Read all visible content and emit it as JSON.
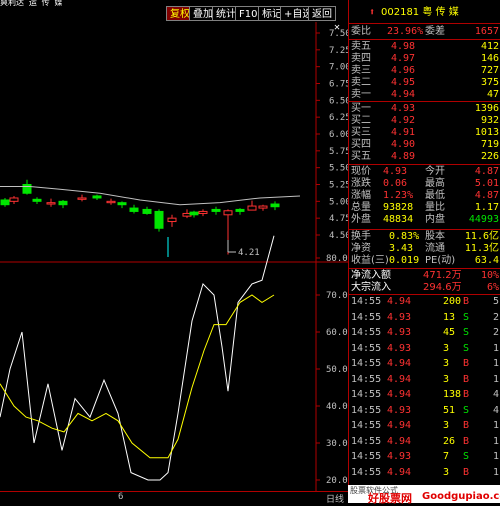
{
  "topbar": {
    "title": "爽利达 运 传 媒",
    "buttons": [
      "复权",
      "叠加",
      "统计",
      "F10",
      "标记",
      "+自选",
      "返回"
    ],
    "close": "✕"
  },
  "stock": {
    "arrow": "⬆",
    "code_name": "002181 粤 传 媒"
  },
  "weibi": {
    "label": "委比",
    "value": "23.96%",
    "label2": "委差",
    "value2": "1657"
  },
  "asks": [
    {
      "label": "卖五",
      "price": "4.98",
      "vol": "412"
    },
    {
      "label": "卖四",
      "price": "4.97",
      "vol": "146"
    },
    {
      "label": "卖三",
      "price": "4.96",
      "vol": "727"
    },
    {
      "label": "卖二",
      "price": "4.95",
      "vol": "375"
    },
    {
      "label": "卖一",
      "price": "4.94",
      "vol": "47"
    }
  ],
  "bids": [
    {
      "label": "买一",
      "price": "4.93",
      "vol": "1396"
    },
    {
      "label": "买二",
      "price": "4.92",
      "vol": "932"
    },
    {
      "label": "买三",
      "price": "4.91",
      "vol": "1013"
    },
    {
      "label": "买四",
      "price": "4.90",
      "vol": "719"
    },
    {
      "label": "买五",
      "price": "4.89",
      "vol": "226"
    }
  ],
  "quote": [
    {
      "l1": "现价",
      "v1": "4.93",
      "l2": "今开",
      "v2": "4.87"
    },
    {
      "l1": "涨跌",
      "v1": "0.06",
      "l2": "最高",
      "v2": "5.01"
    },
    {
      "l1": "涨幅",
      "v1": "1.23%",
      "l2": "最低",
      "v2": "4.87"
    },
    {
      "l1": "总量",
      "v1": "93828",
      "l2": "量比",
      "v2": "1.17"
    },
    {
      "l1": "外盘",
      "v1": "48834",
      "l2": "内盘",
      "v2": "44993"
    }
  ],
  "stats": [
    {
      "l1": "换手",
      "v1": "0.83%",
      "l2": "股本",
      "v2": "11.6亿"
    },
    {
      "l1": "净资",
      "v1": "3.43",
      "l2": "流通",
      "v2": "11.3亿"
    },
    {
      "l1": "收益(三)",
      "v1": "0.019",
      "l2": "PE(动)",
      "v2": "63.4"
    }
  ],
  "flows": [
    {
      "label": "净流入额",
      "value": "471.2万",
      "pct": "10%"
    },
    {
      "label": "大宗流入",
      "value": "294.6万",
      "pct": "6%"
    }
  ],
  "ticks": [
    {
      "time": "14:55",
      "price": "4.94",
      "vol": "200",
      "side": "B",
      "n": "5"
    },
    {
      "time": "14:55",
      "price": "4.93",
      "vol": "13",
      "side": "S",
      "n": "2"
    },
    {
      "time": "14:55",
      "price": "4.93",
      "vol": "45",
      "side": "S",
      "n": "2"
    },
    {
      "time": "14:55",
      "price": "4.93",
      "vol": "3",
      "side": "S",
      "n": "1"
    },
    {
      "time": "14:55",
      "price": "4.94",
      "vol": "3",
      "side": "B",
      "n": "1"
    },
    {
      "time": "14:55",
      "price": "4.94",
      "vol": "3",
      "side": "B",
      "n": "1"
    },
    {
      "time": "14:55",
      "price": "4.94",
      "vol": "138",
      "side": "B",
      "n": "4"
    },
    {
      "time": "14:55",
      "price": "4.93",
      "vol": "51",
      "side": "S",
      "n": "4"
    },
    {
      "time": "14:55",
      "price": "4.94",
      "vol": "3",
      "side": "B",
      "n": "1"
    },
    {
      "time": "14:55",
      "price": "4.94",
      "vol": "26",
      "side": "B",
      "n": "1"
    },
    {
      "time": "14:55",
      "price": "4.93",
      "vol": "7",
      "side": "S",
      "n": "1"
    },
    {
      "time": "14:55",
      "price": "4.94",
      "vol": "3",
      "side": "B",
      "n": "1"
    }
  ],
  "price_axis": [
    "7.50",
    "7.25",
    "7.00",
    "6.75",
    "6.50",
    "6.25",
    "6.00",
    "5.75",
    "5.50",
    "5.25",
    "5.00",
    "4.75",
    "4.50"
  ],
  "low_marker": "4.21",
  "ind_axis": [
    "80.00",
    "70.00",
    "60.00",
    "50.00",
    "40.00",
    "30.00",
    "20.00"
  ],
  "bottom": {
    "label": "6",
    "right": "日线"
  },
  "watermark": {
    "main": "好股票网",
    "sub": "Goodgupiao.com",
    "small": "股票软件公式"
  },
  "colors": {
    "up": "#ff3232",
    "down": "#00e600",
    "border": "#b00000"
  }
}
